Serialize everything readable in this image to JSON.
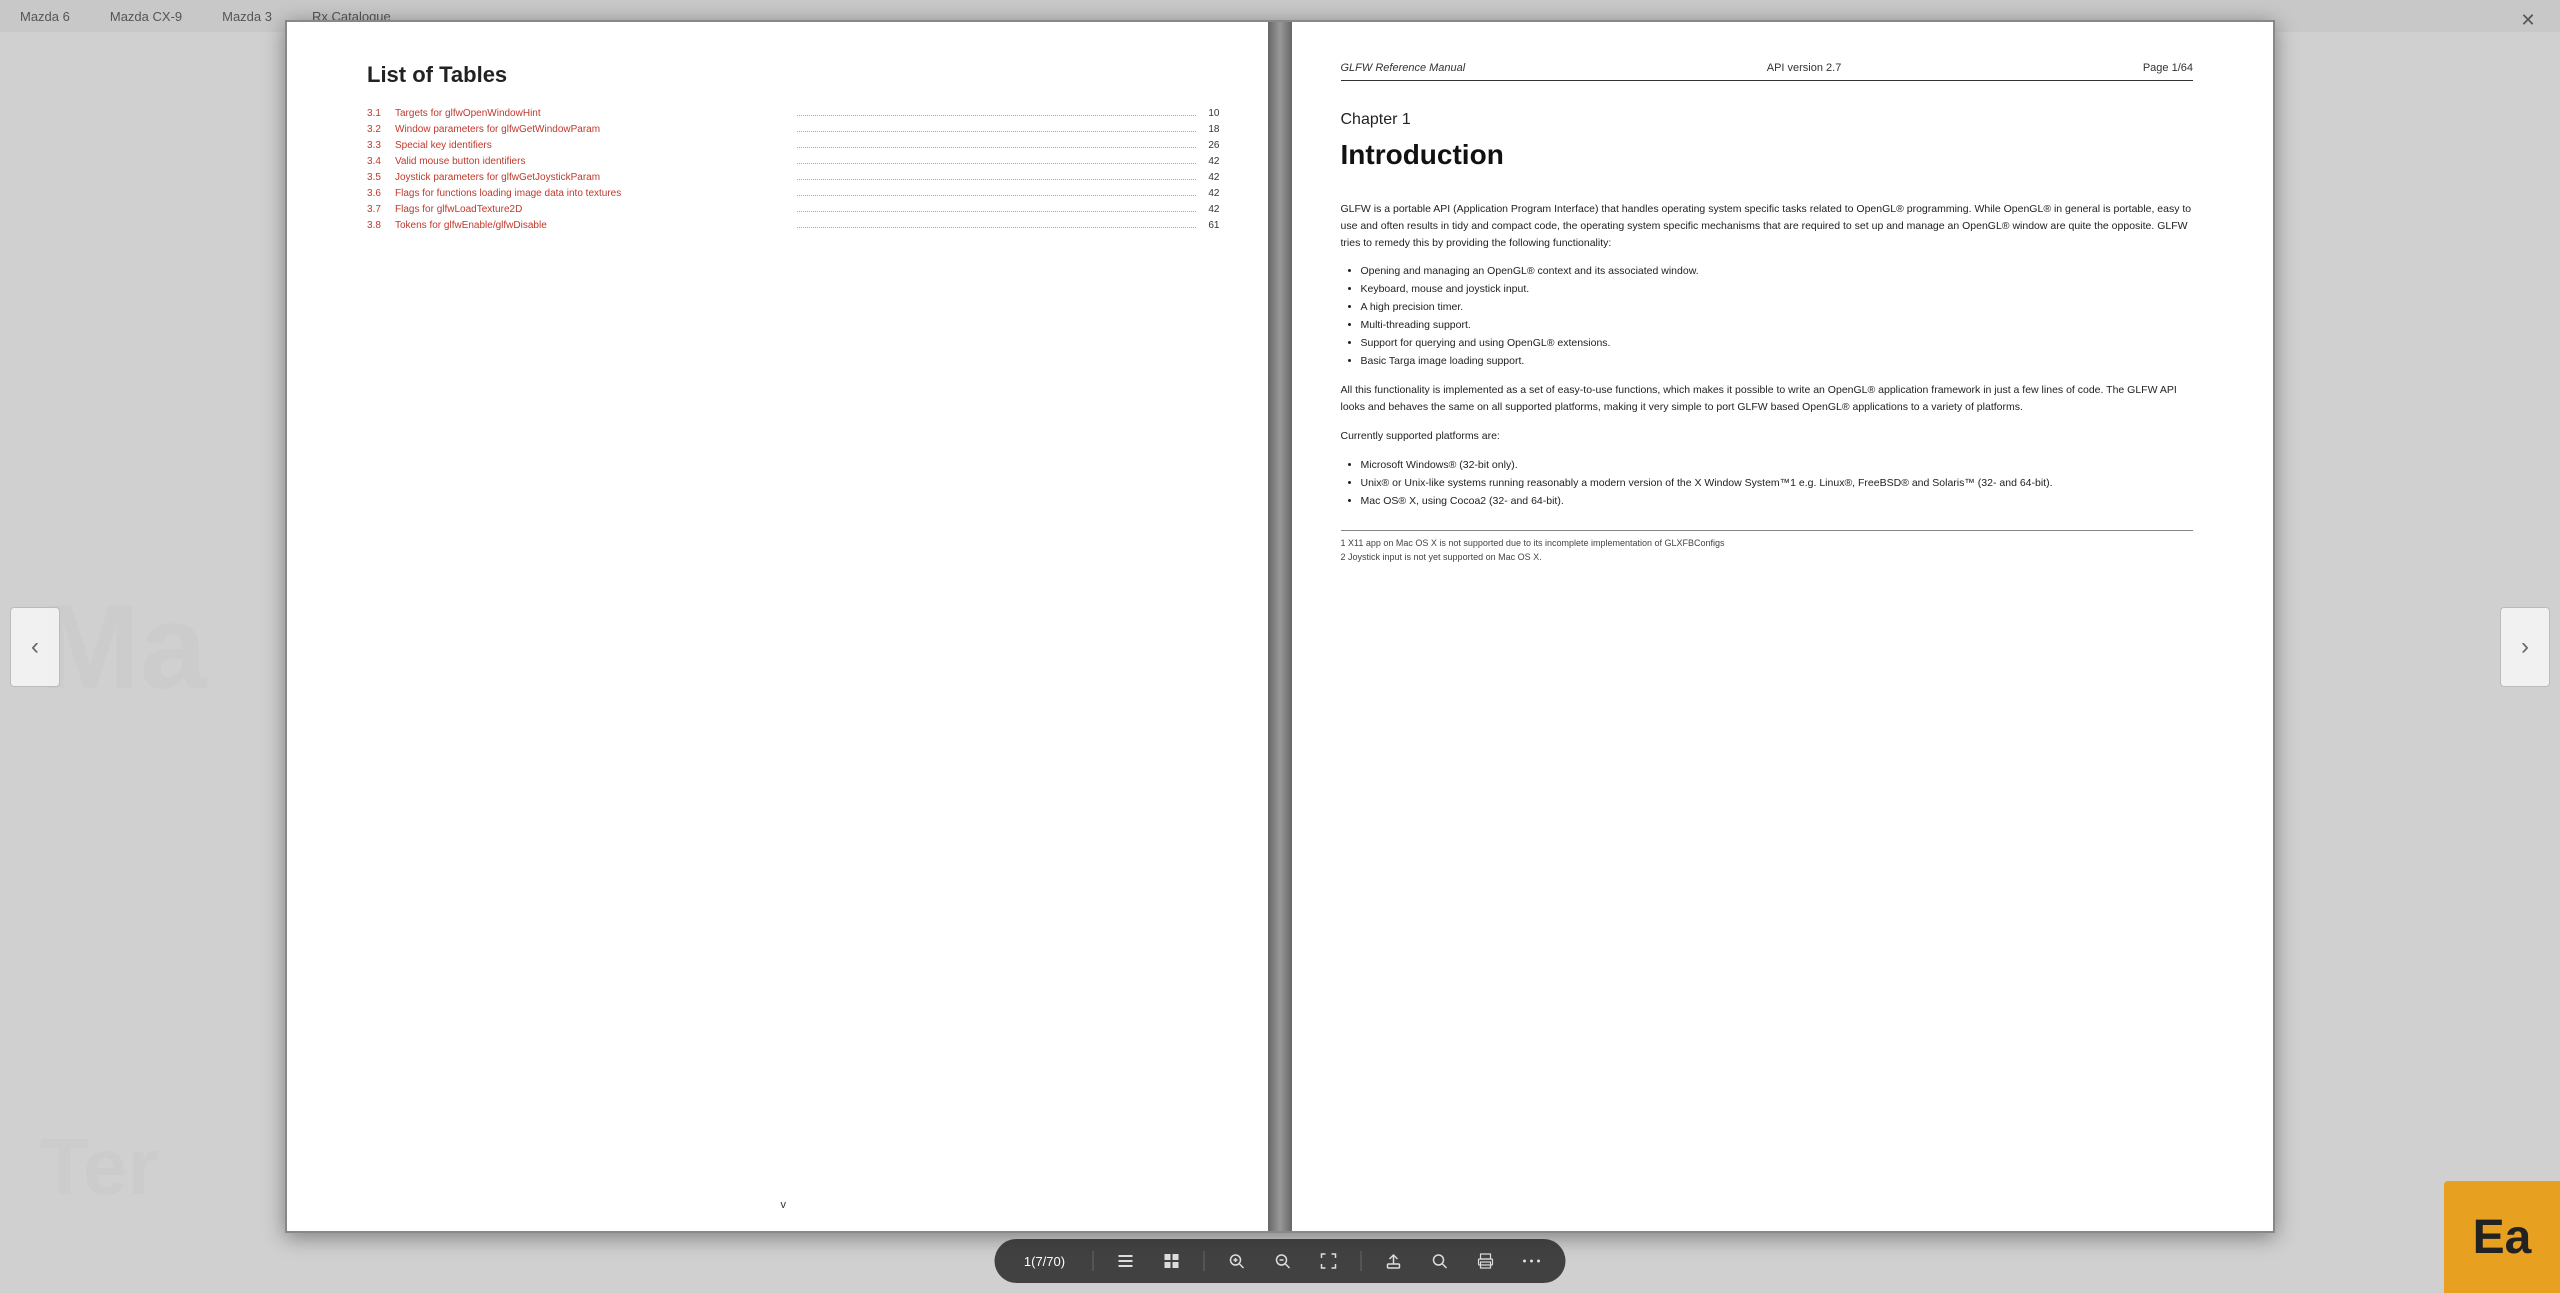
{
  "tabs": [
    {
      "label": "Mazda 6"
    },
    {
      "label": "Mazda CX-9"
    },
    {
      "label": "Mazda 3"
    },
    {
      "label": "Rx Catalogue"
    }
  ],
  "watermark": {
    "top": "Ma",
    "bottom": "Ter"
  },
  "book": {
    "left_page": {
      "heading": "List of Tables",
      "entries": [
        {
          "num": "3.1",
          "label": "Targets for glfwOpenWindowHint",
          "link_start": "glfwOpenWindowHint",
          "page": "10"
        },
        {
          "num": "3.2",
          "label": "Window parameters for glfwGetWindowParam",
          "link_part": "glfwGetWindowParam",
          "page": "18"
        },
        {
          "num": "3.3",
          "label": "Special key identifiers",
          "page": "26"
        },
        {
          "num": "3.4",
          "label": "Valid mouse button identifiers",
          "page": "42"
        },
        {
          "num": "3.5",
          "label": "Joystick parameters for glfwGetJoystickParam",
          "link_part": "glfwGetJoystickParam",
          "page": "42"
        },
        {
          "num": "3.6",
          "label": "Flags for functions loading image data into textures",
          "page": "42"
        },
        {
          "num": "3.7",
          "label": "Flags for glfwLoadTexture2D",
          "link_part": "glfwLoadTexture2D",
          "page": "42"
        },
        {
          "num": "3.8",
          "label": "Tokens for glfwEnable/glfwDisable",
          "link_part": "glfwEnable/glfwDisable",
          "page": "61"
        }
      ],
      "page_num": "v"
    },
    "right_page": {
      "header_title": "GLFW Reference Manual",
      "header_api": "API version 2.7",
      "header_page": "Page 1/64",
      "chapter_num": "Chapter 1",
      "chapter_title": "Introduction",
      "intro_para1": "GLFW is a portable API (Application Program Interface) that handles operating system specific tasks related to OpenGL® programming. While OpenGL® in general is portable, easy to use and often results in tidy and compact code, the operating system specific mechanisms that are required to set up and manage an OpenGL® window are quite the opposite. GLFW tries to remedy this by providing the following functionality:",
      "bullet1": "Opening and managing an OpenGL® context and its associated window.",
      "bullet2": "Keyboard, mouse and joystick input.",
      "bullet3": "A high precision timer.",
      "bullet4": "Multi-threading support.",
      "bullet5": "Support for querying and using OpenGL® extensions.",
      "bullet6": "Basic Targa image loading support.",
      "para2": "All this functionality is implemented as a set of easy-to-use functions, which makes it possible to write an OpenGL® application framework in just a few lines of code. The GLFW API looks and behaves the same on all supported platforms, making it very simple to port GLFW based OpenGL® applications to a variety of platforms.",
      "para3": "Currently supported platforms are:",
      "platform1": "Microsoft Windows® (32-bit only).",
      "platform2": "Unix® or Unix-like systems running reasonably a modern version of the X Window System™1 e.g. Linux®, FreeBSD® and Solaris™ (32- and 64-bit).",
      "platform3": "Mac OS® X, using Cocoa2 (32- and 64-bit).",
      "footnote1": "1 X11 app on Mac OS X is not supported due to its incomplete implementation of GLXFBConfigs",
      "footnote2": "2 Joystick input is not yet supported on Mac OS X."
    }
  },
  "toolbar": {
    "page_display": "1(7/70)",
    "btn_list": "☰",
    "btn_grid": "⊞",
    "btn_zoom_in": "+",
    "btn_zoom_out": "−",
    "btn_fullscreen": "⛶",
    "btn_share": "⬆",
    "btn_search": "🔍",
    "btn_print": "🖨",
    "btn_more": "•••"
  },
  "ea_badge": "Ea",
  "close_btn": "✕",
  "nav_left": "‹",
  "nav_right": "›"
}
